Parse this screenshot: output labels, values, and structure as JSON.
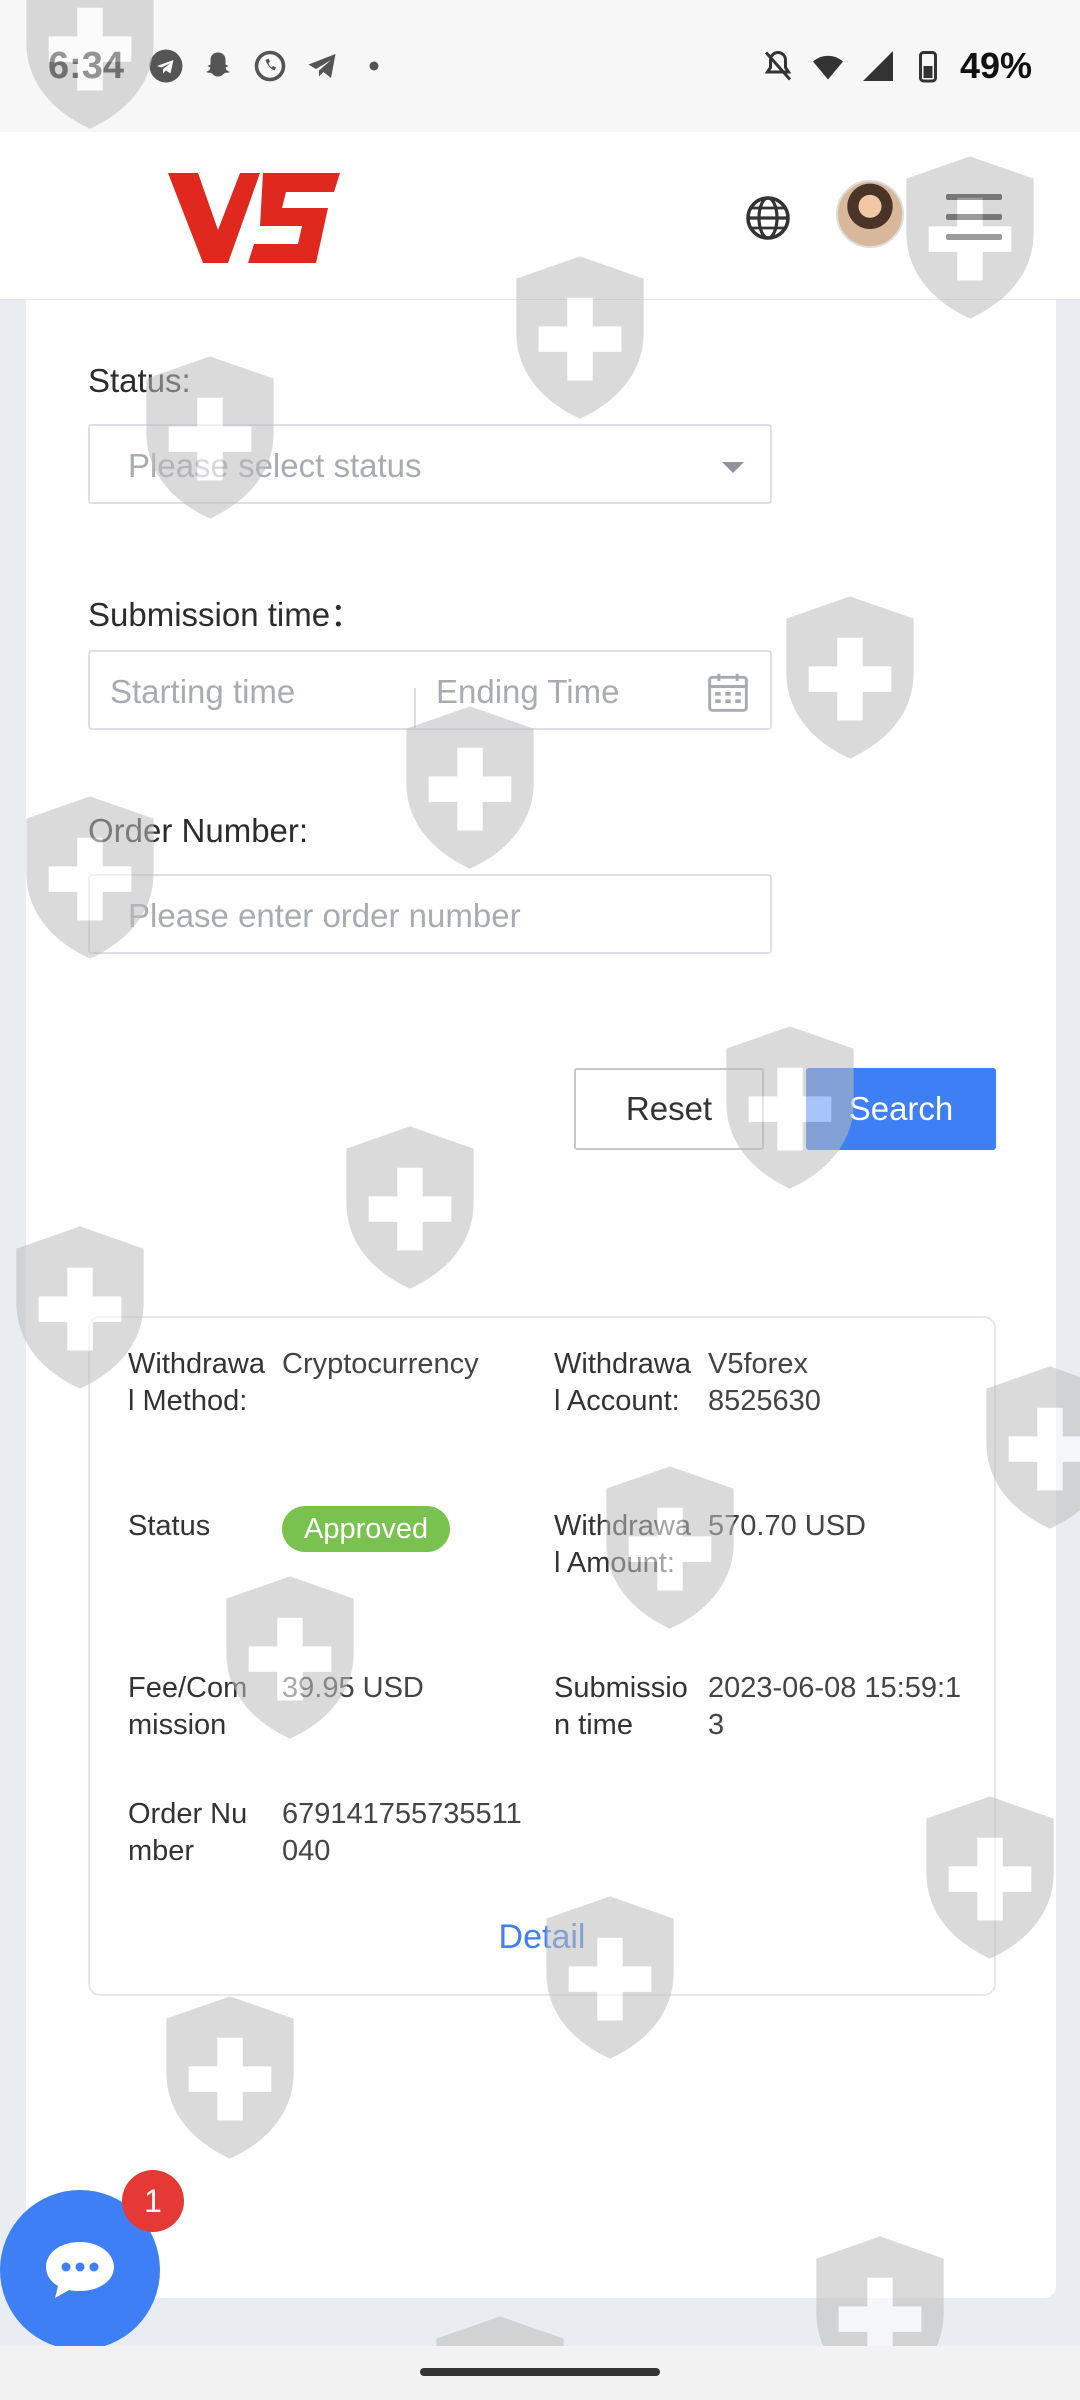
{
  "status_bar": {
    "time": "6:34",
    "battery": "49%",
    "icons": [
      "telegram-icon",
      "snapchat-icon",
      "whatsapp-icon",
      "telegram-icon",
      "dot-icon",
      "mute-icon",
      "wifi-icon",
      "signal-icon",
      "battery-icon"
    ]
  },
  "header": {
    "logo_text": "V5",
    "brand_color": "#e0281e",
    "icons": [
      "globe-icon",
      "avatar",
      "menu-icon"
    ]
  },
  "filters": {
    "status_label": "Status:",
    "status_placeholder": "Please select status",
    "submission_label": "Submission time：",
    "start_placeholder": "Starting time",
    "end_placeholder": "Ending Time",
    "order_label": "Order Number:",
    "order_placeholder": "Please enter order number"
  },
  "buttons": {
    "reset": "Reset",
    "search": "Search"
  },
  "record": {
    "method_label": "Withdrawal Method:",
    "method_value": "Cryptocurrency",
    "account_label": "Withdrawal Account:",
    "account_value": "V5forex 8525630",
    "status_label": "Status",
    "status_value": "Approved",
    "amount_label": "Withdrawal Amount:",
    "amount_value": "570.70 USD",
    "fee_label": "Fee/Commission",
    "fee_value": "39.95 USD",
    "time_label": "Submission time",
    "time_value": "2023-06-08 15:59:13",
    "order_label": "Order Number",
    "order_value": "679141755735511040",
    "detail_link": "Detail"
  },
  "chat": {
    "badge_count": "1"
  },
  "colors": {
    "primary": "#3f7ff5",
    "success": "#7ac24f",
    "badge": "#e53935"
  }
}
